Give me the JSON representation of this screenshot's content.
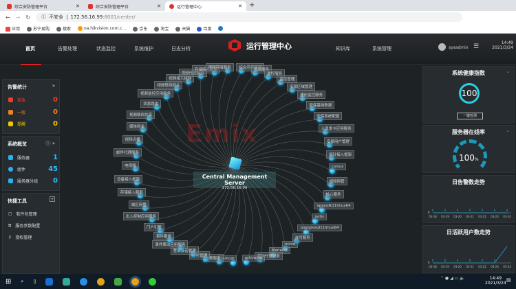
{
  "browser": {
    "tabs": [
      {
        "label": "综合安防管理平台"
      },
      {
        "label": "综合安防管理平台"
      },
      {
        "label": "运行管理中心"
      }
    ],
    "security": "不安全",
    "url_host": "172.56.16.99",
    "url_rest": ":8001/center/",
    "bookmarks": [
      "应用",
      "苏宁易购",
      "搜索",
      "oa.hikvision.com.c...",
      "京东",
      "淘宝",
      "天猫",
      "百度"
    ]
  },
  "nav": {
    "items": [
      "首页",
      "告警处理",
      "状态监控",
      "系统维护",
      "日志分析"
    ],
    "right_items": [
      "知识库",
      "系统管理"
    ],
    "title": "运行管理中心",
    "user": "sysadmin",
    "time": "14:49",
    "date": "2021/3/24"
  },
  "alarm": {
    "title": "告警统计",
    "rows": [
      {
        "label": "紧急",
        "value": "0",
        "color": "#e8402a"
      },
      {
        "label": "一般",
        "value": "0",
        "color": "#f08020"
      },
      {
        "label": "提醒",
        "value": "0",
        "color": "#f0c800"
      }
    ]
  },
  "overview": {
    "title": "系统概览",
    "rows": [
      {
        "label": "服务器",
        "value": "1"
      },
      {
        "label": "组件",
        "value": "45"
      },
      {
        "label": "服务器分组",
        "value": "0"
      }
    ]
  },
  "tools": {
    "title": "快捷工具",
    "items": [
      "软件包管理",
      "服务参数配置",
      "授权管理"
    ]
  },
  "health": {
    "title": "系统健康指数",
    "value": "100",
    "button": "一键检测"
  },
  "online": {
    "title": "服务器在线率",
    "value": "100",
    "unit": "%",
    "percent": 100
  },
  "chart_data": [
    {
      "type": "line",
      "title": "日告警数走势",
      "categories": [
        "03-18",
        "03-19",
        "03-20",
        "03-21",
        "03-22",
        "03-23",
        "03-24"
      ],
      "values": [
        0,
        0,
        0,
        0,
        0,
        0,
        0
      ],
      "ylim": [
        0,
        1
      ]
    },
    {
      "type": "line",
      "title": "日活跃用户数走势",
      "categories": [
        "03-18",
        "03-19",
        "03-20",
        "03-21",
        "03-22",
        "03-23",
        "03-24"
      ],
      "values": [
        0,
        0,
        0,
        0,
        0,
        0,
        1
      ],
      "ylim": [
        0,
        1
      ]
    }
  ],
  "center": {
    "name": "Central Management Server",
    "ip": "172.56.16.99",
    "watermark": "Emix"
  },
  "components": [
    "综合应用服务",
    "视频服务",
    "监控服务",
    "监控管理",
    "安保区域管理",
    "通用监控服务",
    "安保基础数据",
    "安保系统配置",
    "人员发卡应用服务",
    "安保用户管理",
    "探针接入框架",
    "consul",
    "视频网管",
    "核心服务",
    "openjdk11linux64",
    "redis",
    "postgresql11linux64",
    "许可服务",
    "minio",
    "MariaDB",
    "基础代理服务",
    "activemq",
    "tomcat",
    "告警服务",
    "许可管理",
    "登录会话管理",
    "事件联动应用服务",
    "事件服务",
    "门户引擎",
    "出入控制应用服务",
    "城区网管",
    "存储接入服务",
    "设备接入框架",
    "电视墙",
    "邮件代理服务",
    "视频点播",
    "媒体网关",
    "视频联网共享",
    "消息路由",
    "视频监控应用服务",
    "视频联网网关",
    "视频接入组件",
    "视频代理服务",
    "存储接入组件",
    "视频存储服务"
  ],
  "taskbar": {
    "time": "14:49",
    "date": "2021/3/24"
  }
}
